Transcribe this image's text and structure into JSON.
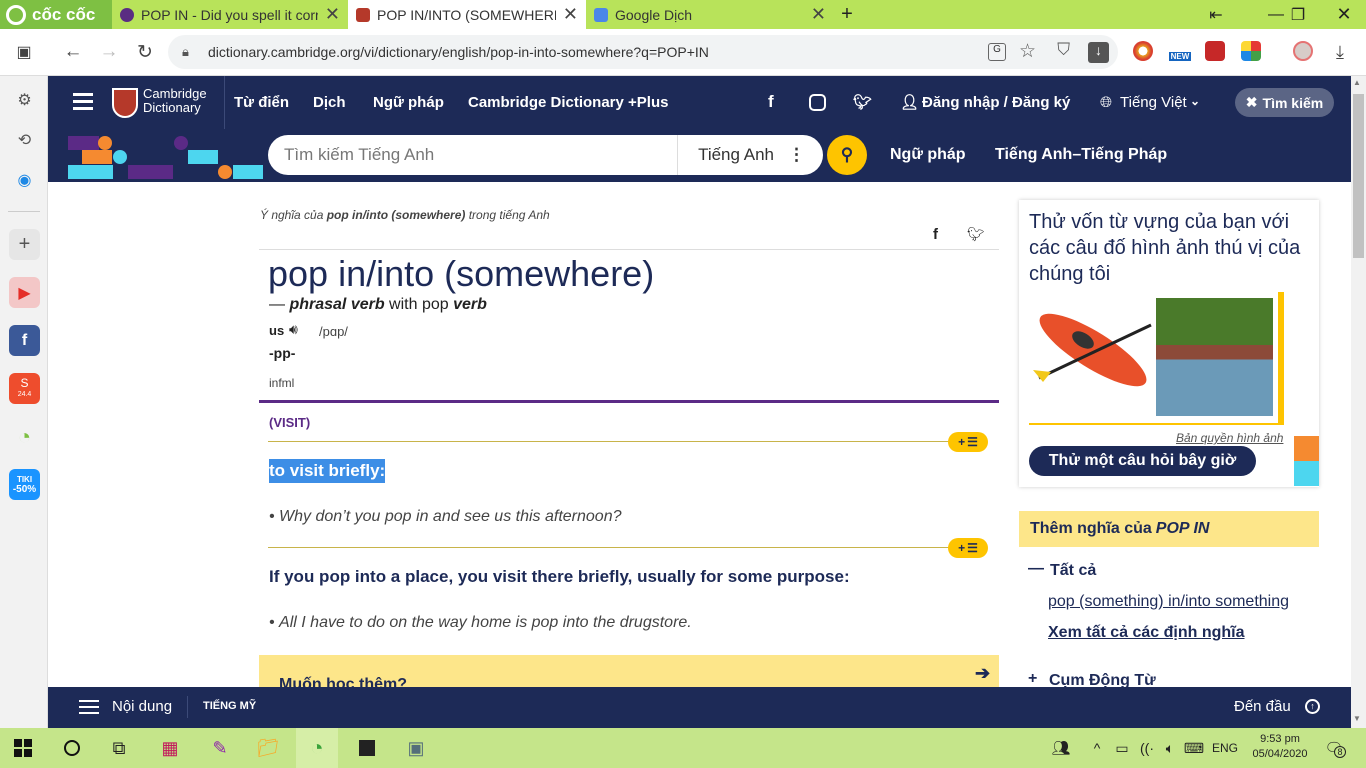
{
  "browser": {
    "brand": "cốc cốc",
    "tabs": [
      {
        "title": "POP IN - Did you spell it corre",
        "active": false
      },
      {
        "title": "POP IN/INTO (SOMEWHERE)",
        "active": true
      },
      {
        "title": "Google Dịch",
        "active": false
      }
    ],
    "url": "dictionary.cambridge.org/vi/dictionary/english/pop-in-into-somewhere?q=POP+IN",
    "ext_badge": "NEW"
  },
  "sidebar": {
    "shopee_badge": "24.4",
    "tiki_label": "TIKI",
    "tiki_discount": "-50%"
  },
  "header": {
    "logo_line1": "Cambridge",
    "logo_line2": "Dictionary",
    "nav": [
      "Từ điển",
      "Dịch",
      "Ngữ pháp",
      "Cambridge Dictionary +Plus"
    ],
    "login": "Đăng nhập / Đăng ký",
    "language": "Tiếng Việt",
    "search_button": "Tìm kiếm"
  },
  "searchbar": {
    "placeholder": "Tìm kiếm Tiếng Anh",
    "dictionary": "Tiếng Anh",
    "link1": "Ngữ pháp",
    "link2": "Tiếng Anh–Tiếng Pháp"
  },
  "entry": {
    "meaning_prefix": "Ý nghĩa của ",
    "meaning_word": "pop in/into (somewhere)",
    "meaning_suffix": " trong tiếng Anh",
    "headword": "pop in/into (somewhere)",
    "pos_dash": "— ",
    "pos": "phrasal verb",
    "pos_with": " with pop ",
    "pos_verb": "verb",
    "region": "us",
    "ipa": "/pɑp/",
    "inflection": "-pp-",
    "register": "infml",
    "sense_label": "(VISIT)",
    "def1": "to visit briefly:",
    "ex1": "Why don’t you pop in and see us this afternoon?",
    "def2": "If you pop into a place, you visit there briefly, usually for some purpose:",
    "ex2": "All I have to do on the way home is pop into the drugstore.",
    "learn_more": "Muốn học thêm?",
    "plus_label": "+"
  },
  "right": {
    "quiz_text": "Thử vốn từ vựng của bạn với các câu đố hình ảnh thú vị của chúng tôi",
    "copyright": "Bản quyền hình ảnh",
    "quiz_button": "Thử một câu hỏi bây giờ",
    "more_prefix": "Thêm nghĩa của ",
    "more_word": "POP IN",
    "all_label": "Tất cả",
    "link1": "pop (something) in/into something",
    "link2": "Xem tất cả các định nghĩa",
    "phrasal": "Cụm Động Từ"
  },
  "footer": {
    "contents": "Nội dung",
    "us": "TIẾNG MỸ",
    "top": "Đến đầu"
  },
  "taskbar": {
    "lang": "ENG",
    "time": "9:53 pm",
    "date": "05/04/2020",
    "notif_count": "8"
  },
  "colors": {
    "cambridge_navy": "#1d2a57",
    "accent_yellow": "#fec400",
    "sense_purple": "#5b2a86",
    "taskbar_green": "#c5e58a"
  }
}
